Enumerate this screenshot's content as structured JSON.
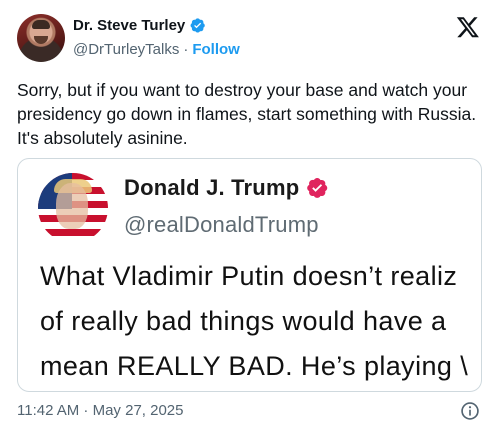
{
  "author": {
    "display_name": "Dr. Steve Turley",
    "handle": "@DrTurleyTalks",
    "separator": "·",
    "follow_label": "Follow",
    "verified_color": "#1d9bf0"
  },
  "brand_icon": "x-logo-icon",
  "tweet": {
    "text": "Sorry, but if you want to destroy your base and watch your presidency go down in flames, start something with Russia. It's absolutely asinine."
  },
  "quoted": {
    "display_name": "Donald J. Trump",
    "handle": "@realDonaldTrump",
    "badge_color": "#e0245e",
    "lines": [
      "What Vladimir Putin doesn’t realiz",
      "of really bad things would have a",
      "mean REALLY BAD. He’s playing \\"
    ]
  },
  "footer": {
    "timestamp": "11:42 AM · May 27, 2025",
    "info_icon": "info-icon"
  }
}
